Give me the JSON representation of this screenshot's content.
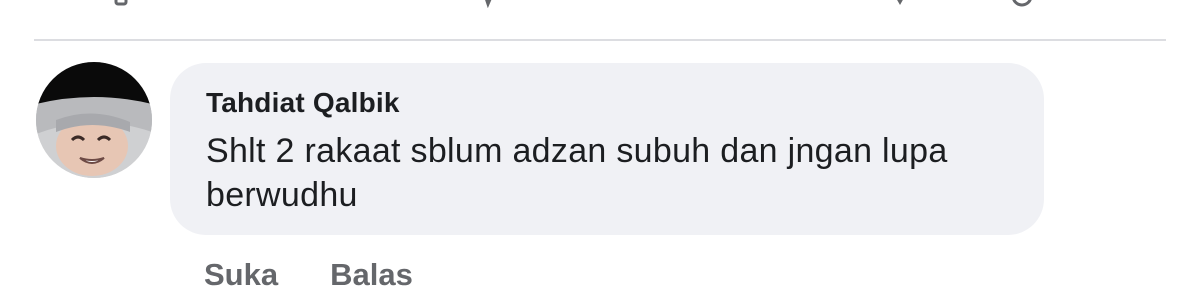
{
  "icons": {
    "like": "like-icon",
    "comment": "comment-icon",
    "share": "share-icon",
    "reaction": "reaction-icon"
  },
  "colors": {
    "bubble": "#f0f1f5",
    "author": "#1c1e21",
    "meta": "#65676b",
    "divider": "#dcdde1"
  },
  "comment": {
    "author": "Tahdiat Qalbik",
    "text": "Shlt 2 rakaat sblum adzan subuh dan jngan lupa berwudhu",
    "actions": {
      "like": "Suka",
      "reply": "Balas"
    }
  }
}
